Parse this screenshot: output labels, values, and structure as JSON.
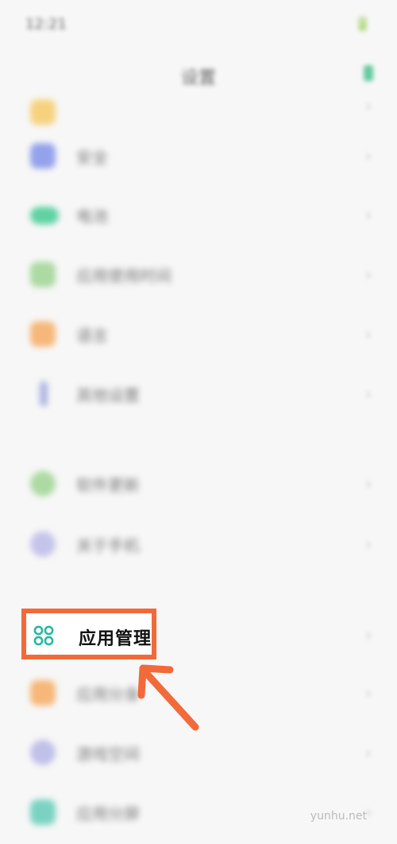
{
  "status_bar": {
    "time": "12:21",
    "icons": "🔋"
  },
  "header": {
    "title": "设置"
  },
  "items": [
    {
      "label": "",
      "value": "",
      "color": "#f6c960"
    },
    {
      "label": "安全",
      "value": "",
      "color": "#7b8ee8"
    },
    {
      "label": "电池",
      "value": "",
      "color": "#39c98e"
    },
    {
      "label": "应用使用时间",
      "value": "",
      "color": "#9ad38d"
    },
    {
      "label": "语言",
      "value": "",
      "color": "#f6a85a"
    },
    {
      "label": "其他设置",
      "value": "",
      "color": "#9aa3dd"
    },
    {
      "label": "软件更新",
      "value": "",
      "color": "#9ad38d"
    },
    {
      "label": "关于手机",
      "value": "",
      "color": "#b8b8e8"
    },
    {
      "label": "应用分身",
      "value": "",
      "color": "#f6a85a"
    },
    {
      "label": "游戏空间",
      "value": "",
      "color": "#b3b3e6"
    },
    {
      "label": "应用分屏",
      "value": "",
      "color": "#5cc9b6"
    }
  ],
  "highlighted": {
    "label": "应用管理",
    "icon": "apps-grid-icon",
    "color": "#27b8a0"
  },
  "annotation": {
    "arrow_color": "#f26a3a",
    "box_color": "#f26a3a"
  },
  "watermark": "yunhu.net"
}
